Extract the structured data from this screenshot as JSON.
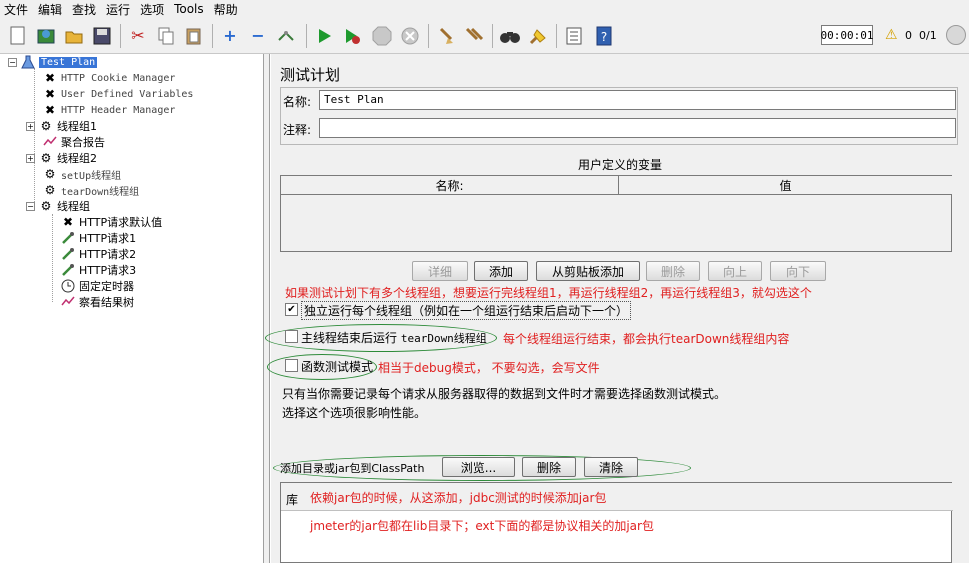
{
  "menu": [
    "文件",
    "编辑",
    "查找",
    "运行",
    "选项",
    "Tools",
    "帮助"
  ],
  "toolbar": {
    "timer": "00:00:01",
    "error_count": "0",
    "thread_count": "0/1"
  },
  "tree": {
    "root": "Test Plan",
    "items": [
      {
        "label": "HTTP Cookie Manager"
      },
      {
        "label": "User Defined Variables"
      },
      {
        "label": "HTTP Header Manager"
      },
      {
        "label": "线程组1"
      },
      {
        "label": "聚合报告"
      },
      {
        "label": "线程组2"
      },
      {
        "label": "setUp线程组"
      },
      {
        "label": "tearDown线程组"
      },
      {
        "label": "线程组"
      },
      {
        "label": "HTTP请求默认值"
      },
      {
        "label": "HTTP请求1"
      },
      {
        "label": "HTTP请求2"
      },
      {
        "label": "HTTP请求3"
      },
      {
        "label": "固定定时器"
      },
      {
        "label": "察看结果树"
      }
    ]
  },
  "panel": {
    "title": "测试计划",
    "name_label": "名称:",
    "name_value": "Test Plan",
    "comment_label": "注释:",
    "vars_caption": "用户定义的变量",
    "vars_col_name": "名称:",
    "vars_col_value": "值",
    "buttons": {
      "detail": "详细",
      "add": "添加",
      "add_clipboard": "从剪贴板添加",
      "delete": "删除",
      "up": "向上",
      "down": "向下"
    },
    "note_serial": "如果测试计划下有多个线程组，想要运行完线程组1，再运行线程组2，再运行线程组3，就勾选这个",
    "cb_serial": "独立运行每个线程组（例如在一个组运行结束后启动下一个）",
    "cb_teardown_prefix": "主线程结束后运行 ",
    "cb_teardown_mono": "tearDown线程组",
    "note_teardown": "每个线程组运行结束，都会执行tearDown线程组内容",
    "cb_functional": "函数测试模式",
    "note_functional": "相当于debug模式， 不要勾选，会写文件",
    "info_line1": "只有当你需要记录每个请求从服务器取得的数据到文件时才需要选择函数测试模式。",
    "info_line2": "选择这个选项很影响性能。",
    "classpath_label": "添加目录或jar包到ClassPath",
    "browse_btn": "浏览...",
    "delete_btn": "删除",
    "clear_btn": "清除",
    "lib_header": "库",
    "note_lib1": "依赖jar包的时候，从这添加，jdbc测试的时候添加jar包",
    "note_lib2": "jmeter的jar包都在lib目录下；ext下面的都是协议相关的加jar包"
  },
  "colors": {
    "annotation_red": "#e02020",
    "annotation_green": "#2e8b3a",
    "selection_blue": "#3875d7"
  }
}
